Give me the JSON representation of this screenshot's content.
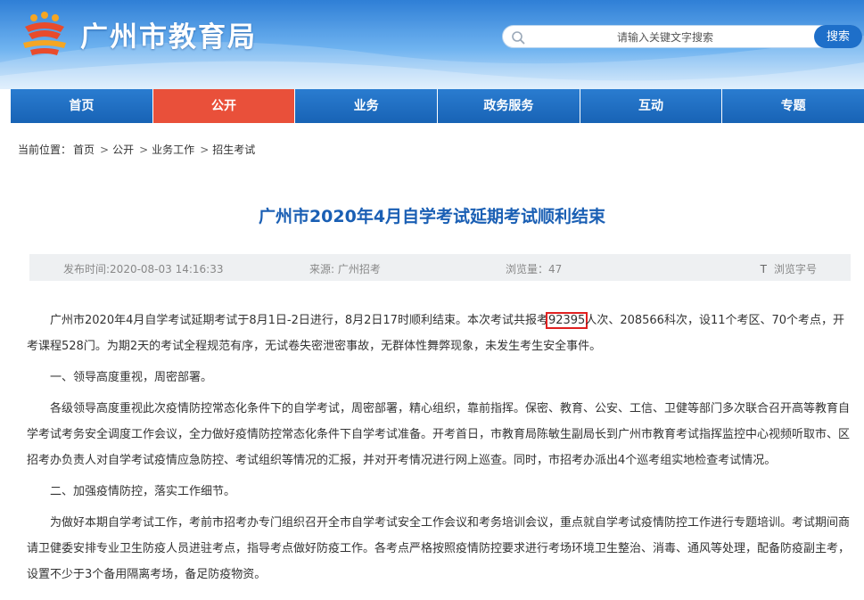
{
  "header": {
    "site_title": "广州市教育局",
    "search_placeholder": "请输入关键文字搜索",
    "search_button": "搜索"
  },
  "nav": {
    "items": [
      {
        "label": "首页"
      },
      {
        "label": "公开"
      },
      {
        "label": "业务"
      },
      {
        "label": "政务服务"
      },
      {
        "label": "互动"
      },
      {
        "label": "专题"
      }
    ],
    "active": "公开"
  },
  "breadcrumb": {
    "prefix": "当前位置：",
    "items": [
      "首页",
      "公开",
      "业务工作",
      "招生考试"
    ],
    "separator": ">"
  },
  "article": {
    "title": "广州市2020年4月自学考试延期考试顺利结束",
    "publish_time": "发布时间:2020-08-03 14:16:33",
    "source": "来源: 广州招考",
    "views": "浏览量：47",
    "font_icon": "T",
    "font_label": "浏览字号",
    "p1_before": "广州市2020年4月自学考试延期考试于8月1日-2日进行，8月2日17时顺利结束。本次考试共报考",
    "p1_highlight": "92395",
    "p1_after": "人次、208566科次，设11个考区、70个考点，开考课程528门。为期2天的考试全程规范有序，无试卷失密泄密事故，无群体性舞弊现象，未发生考生安全事件。",
    "p2": "一、领导高度重视，周密部署。",
    "p3": "各级领导高度重视此次疫情防控常态化条件下的自学考试，周密部署，精心组织，靠前指挥。保密、教育、公安、工信、卫健等部门多次联合召开高等教育自学考试考务安全调度工作会议，全力做好疫情防控常态化条件下自学考试准备。开考首日，市教育局陈敏生副局长到广州市教育考试指挥监控中心视频听取市、区招考办负责人对自学考试疫情应急防控、考试组织等情况的汇报，并对开考情况进行网上巡查。同时，市招考办派出4个巡考组实地检查考试情况。",
    "p4": "二、加强疫情防控，落实工作细节。",
    "p5": "为做好本期自学考试工作，考前市招考办专门组织召开全市自学考试安全工作会议和考务培训会议，重点就自学考试疫情防控工作进行专题培训。考试期间商请卫健委安排专业卫生防疫人员进驻考点，指导考点做好防疫工作。各考点严格按照疫情防控要求进行考场环境卫生整治、消毒、通风等处理，配备防疫副主考，设置不少于3个备用隔离考场，备足防疫物资。"
  },
  "colors": {
    "nav_blue": "#1d6fc4",
    "nav_active": "#e9503a",
    "title_blue": "#1a5fb4",
    "highlight_red": "#e02020"
  },
  "icons": {
    "logo": "education-bureau-logo-icon",
    "search": "search-icon"
  }
}
